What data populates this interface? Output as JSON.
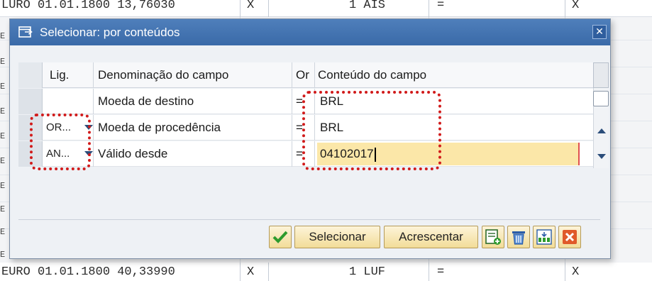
{
  "background": {
    "top_row": {
      "col1": "LURO 01.01.1800 13,76030",
      "col2": "X",
      "col3": "1 AIS",
      "col4": "=",
      "col5": "X"
    },
    "bottom_row": {
      "col1": "EURO 01.01.1800 40,33990",
      "col2": "X",
      "col3": "1 LUF",
      "col4": "=",
      "col5": "X"
    },
    "left_marks": [
      "E",
      "E",
      "E",
      "E",
      "E",
      "E",
      "E",
      "E",
      "E",
      "E"
    ]
  },
  "dialog": {
    "title": "Selecionar: por conteúdos",
    "close_label": "✕",
    "columns": {
      "lig": "Lig.",
      "field_name": "Denominação do campo",
      "or": "Or",
      "content": "Conteúdo do campo"
    },
    "rows": [
      {
        "lig": "",
        "field_name": "Moeda de destino",
        "or": "=",
        "content": "BRL"
      },
      {
        "lig": "OR...",
        "field_name": "Moeda de procedência",
        "or": "=",
        "content": "BRL"
      },
      {
        "lig": "AN...",
        "field_name": "Válido desde",
        "or": "=",
        "content": "04102017"
      }
    ],
    "buttons": {
      "ok_icon": "checkmark-icon",
      "select_label": "Selecionar",
      "add_label": "Acrescentar",
      "icons": [
        "add-row-icon",
        "delete-icon",
        "find-icon",
        "cancel-icon"
      ]
    }
  },
  "colors": {
    "title_bar": "#3a6aa8",
    "highlight": "#d11b1b",
    "active_field": "#fbe7a8",
    "button_face": "#f2dc98"
  }
}
